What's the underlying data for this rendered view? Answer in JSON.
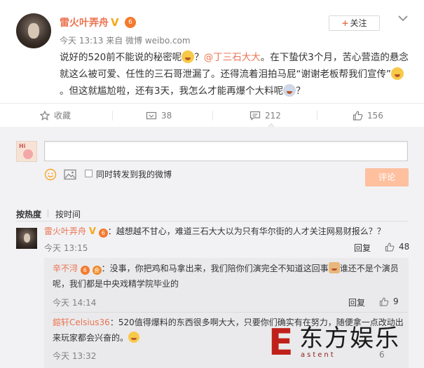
{
  "post": {
    "author": "雷火叶弄舟",
    "verified_mark": "V",
    "level_mark": "⑥",
    "follow_label": "关注",
    "follow_plus": "+",
    "time": "今天 13:13",
    "via": "来自 微博 weibo.com",
    "content_1": "说好的520前不能说的秘密呢",
    "content_2": "？",
    "mention": "@丁三石大大",
    "content_3": "。在下蛰伏3个月，苦心营造的悬念就这么被可爱、任性的三石哥泄漏了。还得流着泪拍马屁“谢谢老板帮我们宣传”",
    "content_4": "。但这就尴尬啦，还有3天，我怎么才能再爆个大料呢",
    "content_5": "？"
  },
  "actions": {
    "favorite_label": "收藏",
    "repost_count": "38",
    "comment_count": "212",
    "like_count": "156"
  },
  "comment_box": {
    "placeholder": "",
    "repost_label": "同时转发到我的微博",
    "submit_label": "评论"
  },
  "sort": {
    "hot": "按热度",
    "time": "按时间"
  },
  "comments": [
    {
      "name": "雷火叶弄舟",
      "text": "：越想越不甘心，难道三石大大以为只有华尔街的人才关注网易财报么？？",
      "time": "今天 13:15",
      "reply": "回复",
      "likes": "48"
    }
  ],
  "replies": [
    {
      "name": "辛不浔",
      "text_1": "：没事，你把鸡和马拿出来，我们陪你们演完全不知道这回事",
      "text_2": "谁还不是个演员呢，我们都是中央戏精学院毕业的",
      "time": "今天 14:14",
      "reply": "回复",
      "likes": "9"
    },
    {
      "name": "鎔轩Celsius36",
      "text_1": "：520值得爆料的东西很多啊大大，只要你们确实有在努力，随便拿一点改动出来玩家都会兴奋的。",
      "time": "今天 13:32",
      "likes": "6"
    }
  ],
  "watermark": {
    "mark": "E",
    "text": "东方娱乐",
    "sub": "astent"
  },
  "colors": {
    "accent": "#eb7350",
    "submit_disabled": "#ffc09f",
    "comments_bg": "#f2f2f5"
  }
}
